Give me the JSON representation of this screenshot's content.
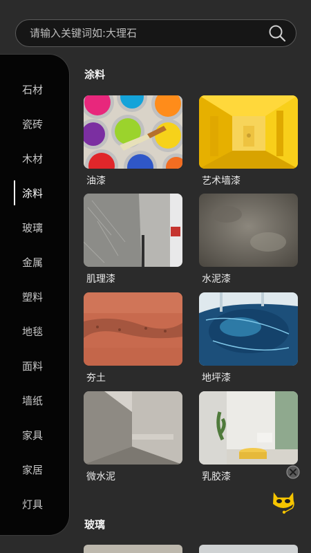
{
  "search": {
    "placeholder": "请输入关键词如:大理石",
    "icon": "search-icon"
  },
  "sidebar": {
    "items": [
      {
        "label": "石材"
      },
      {
        "label": "瓷砖"
      },
      {
        "label": "木材"
      },
      {
        "label": "涂料",
        "active": true
      },
      {
        "label": "玻璃"
      },
      {
        "label": "金属"
      },
      {
        "label": "塑料"
      },
      {
        "label": "地毯"
      },
      {
        "label": "面料"
      },
      {
        "label": "墙纸"
      },
      {
        "label": "家具"
      },
      {
        "label": "家居"
      },
      {
        "label": "灯具"
      }
    ]
  },
  "sections": [
    {
      "title": "涂料",
      "items": [
        {
          "label": "油漆",
          "thumb": "paint-cans-image"
        },
        {
          "label": "艺术墙漆",
          "thumb": "yellow-corridor-image"
        },
        {
          "label": "肌理漆",
          "thumb": "textured-wall-image"
        },
        {
          "label": "水泥漆",
          "thumb": "cement-wall-image"
        },
        {
          "label": "夯土",
          "thumb": "rammed-earth-image"
        },
        {
          "label": "地坪漆",
          "thumb": "epoxy-floor-image"
        },
        {
          "label": "微水泥",
          "thumb": "micro-cement-room-image"
        },
        {
          "label": "乳胶漆",
          "thumb": "latex-paint-room-image"
        }
      ]
    },
    {
      "title": "玻璃"
    }
  ],
  "colors": {
    "background": "#2b2b2b",
    "sidebar": "#050505",
    "accent": "#f5c400"
  }
}
